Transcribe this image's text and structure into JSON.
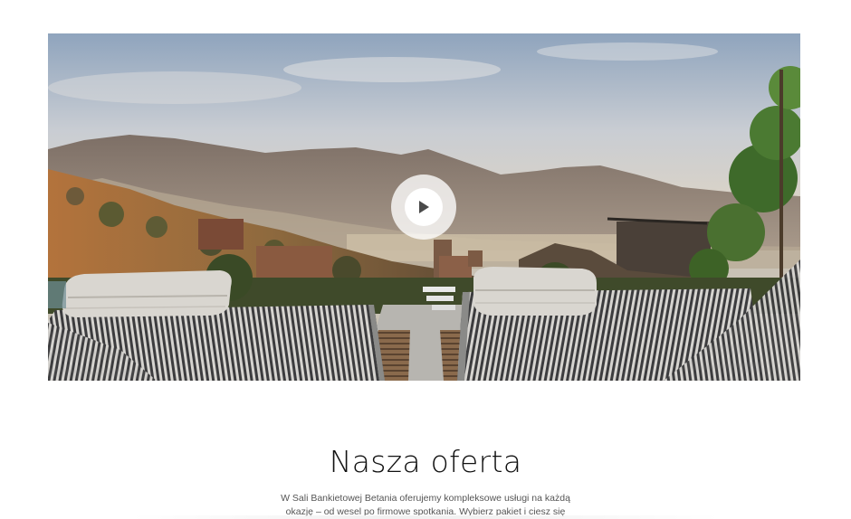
{
  "hero_video": {
    "play_icon": "play-icon"
  },
  "offer": {
    "title": "Nasza oferta",
    "description": "W Sali Bankietowej Betania oferujemy kompleksowe usługi na każdą okazję – od wesel po firmowe spotkania. Wybierz pakiet i ciesz się"
  }
}
